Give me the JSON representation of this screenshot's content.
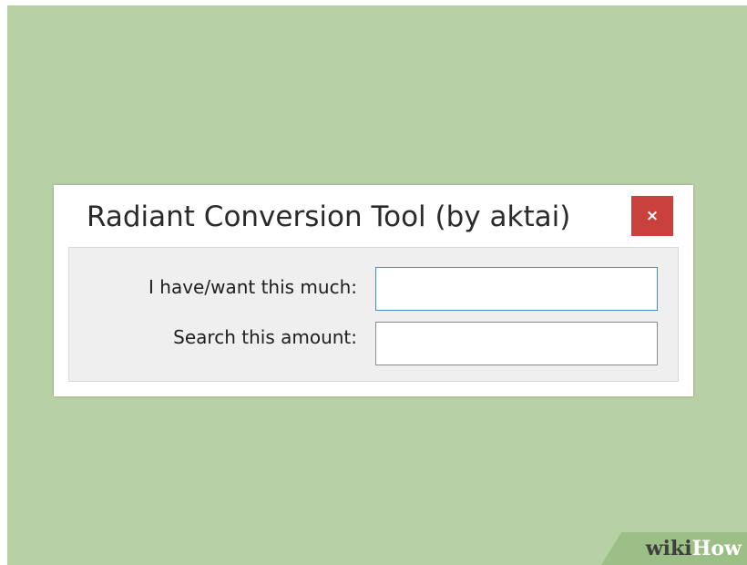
{
  "window": {
    "title": "Radiant Conversion Tool (by aktai)",
    "close_label": "×"
  },
  "form": {
    "field1_label": "I have/want this much:",
    "field1_value": "",
    "field2_label": "Search this amount:",
    "field2_value": ""
  },
  "watermark": {
    "part1": "wiki",
    "part2": "How"
  },
  "colors": {
    "background": "#b8d1a4",
    "close_button": "#c9403d",
    "focus_border": "#3d8fd1"
  }
}
